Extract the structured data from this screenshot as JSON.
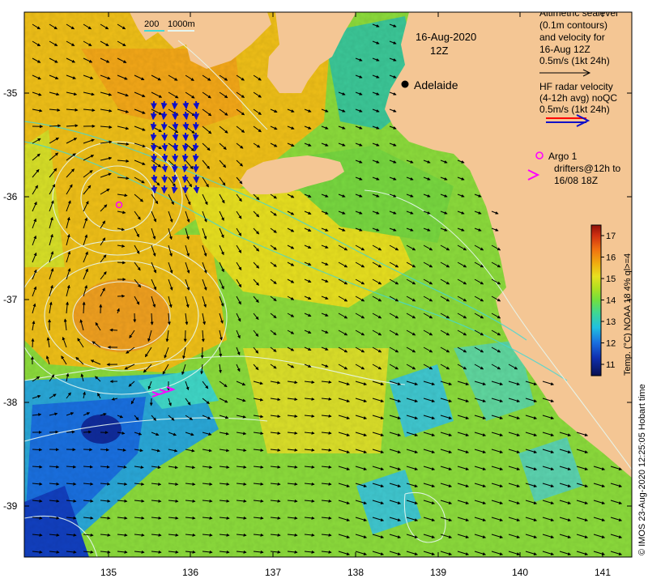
{
  "map": {
    "date": "16-Aug-2020",
    "hour": "12Z",
    "city": "Adelaide",
    "scale_labels": [
      "200",
      "1000m"
    ],
    "lat_ticks": [
      "-35",
      "-36",
      "-37",
      "-38",
      "-39"
    ],
    "lon_ticks": [
      "135",
      "136",
      "137",
      "138",
      "139",
      "140",
      "141"
    ],
    "colors": {
      "land": "#f4c694",
      "vector": "#000000",
      "contour": "#e6f6f0",
      "bathymetry": "#40d8d8",
      "argo": "#ff00ff",
      "drifter": "#ff00ff",
      "hf_radar_blue": "#1010c8",
      "hf_radar_red": "#ff0000"
    }
  },
  "legend": {
    "altimetry_lines": [
      "Altimetric sealevel",
      "(0.1m contours)",
      "and velocity for",
      "16-Aug 12Z",
      "0.5m/s (1kt 24h)"
    ],
    "hf_lines": [
      "HF radar velocity",
      "(4-12h avg) noQC",
      "0.5m/s (1kt 24h)"
    ],
    "argo_label": "Argo 1",
    "drifter_lines": [
      "drifters@12h to",
      "16/08 18Z"
    ]
  },
  "colorbar": {
    "ticks": [
      "11",
      "12",
      "13",
      "14",
      "15",
      "16",
      "17"
    ],
    "label": "Temp. (°C) NOAA 18 4% ql>=4",
    "stops": [
      "#0a1050",
      "#1030b0",
      "#1a70e0",
      "#20c0e0",
      "#40d890",
      "#70e040",
      "#b0e020",
      "#e8e020",
      "#f0b010",
      "#f07010",
      "#d03010",
      "#901008"
    ]
  },
  "credit": "© IMOS 23-Aug-2020 12:25:05 Hobart time"
}
